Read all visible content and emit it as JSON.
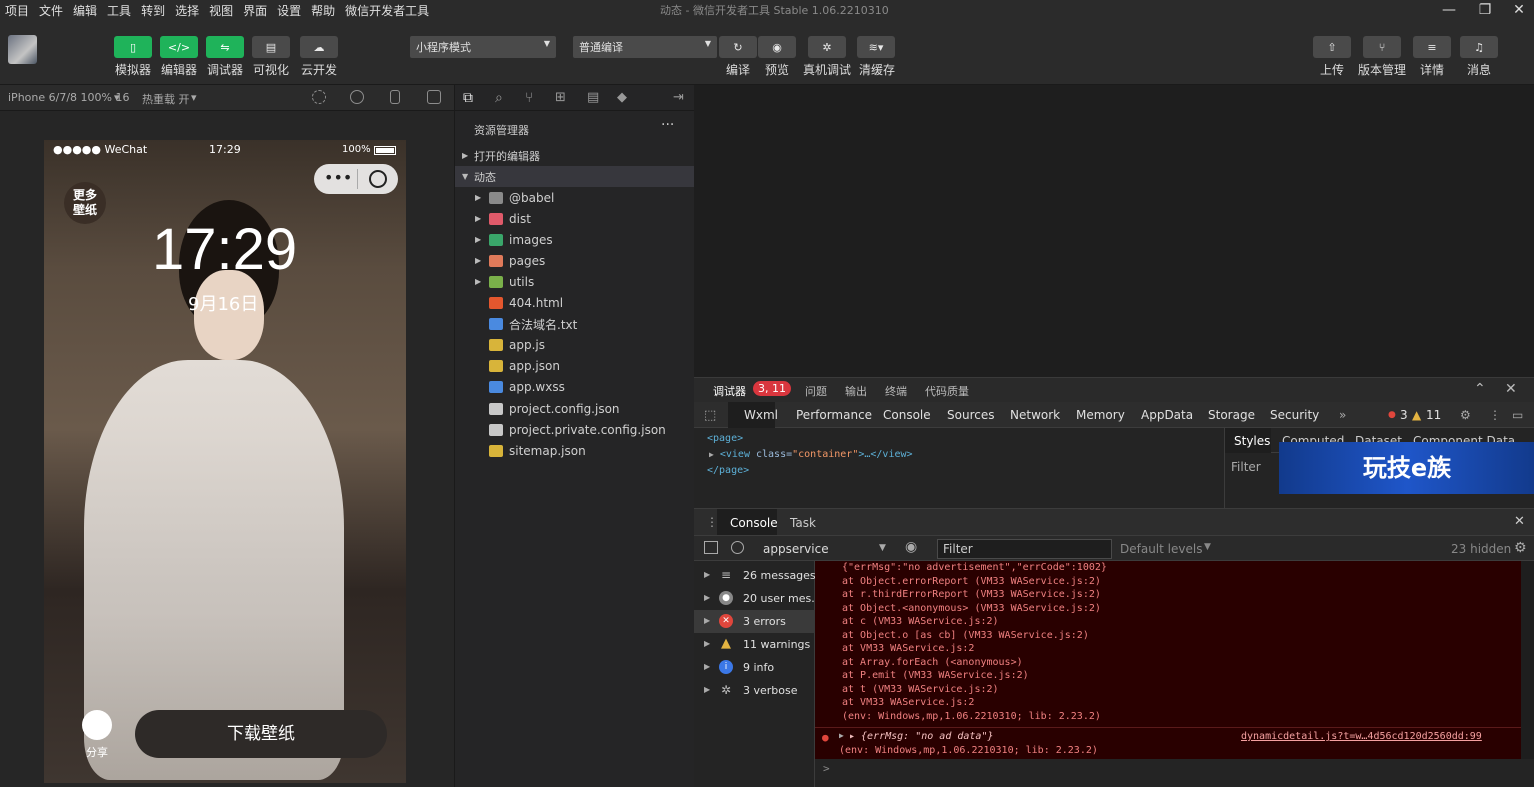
{
  "menubar": {
    "items": [
      "项目",
      "文件",
      "编辑",
      "工具",
      "转到",
      "选择",
      "视图",
      "界面",
      "设置",
      "帮助",
      "微信开发者工具"
    ],
    "window_title": "动态 - 微信开发者工具 Stable 1.06.2210310"
  },
  "toolbar": {
    "simulator": "模拟器",
    "editor": "编辑器",
    "debugger": "调试器",
    "visual": "可视化",
    "cloud": "云开发",
    "mode_select": "小程序模式",
    "compile_select": "普通编译",
    "compile": "编译",
    "preview": "预览",
    "real_debug": "真机调试",
    "clear_cache": "清缓存",
    "upload": "上传",
    "version": "版本管理",
    "detail": "详情",
    "message": "消息"
  },
  "simbar": {
    "device": "iPhone 6/7/8 100% 16",
    "hotreload": "热重载 开"
  },
  "phone": {
    "carrier": "●●●●● WeChat",
    "time": "17:29",
    "battery": "100%",
    "badge": "更多壁纸",
    "clock": "17:29",
    "date": "9月16日",
    "share": "分享",
    "download": "下载壁纸"
  },
  "explorer": {
    "title": "资源管理器",
    "open_editors": "打开的编辑器",
    "project": "动态",
    "items": [
      {
        "name": "@babel",
        "type": "folder",
        "color": "#8a8a8a"
      },
      {
        "name": "dist",
        "type": "folder",
        "color": "#e05a6a"
      },
      {
        "name": "images",
        "type": "folder",
        "color": "#3aa66a"
      },
      {
        "name": "pages",
        "type": "folder",
        "color": "#e07a5a"
      },
      {
        "name": "utils",
        "type": "folder",
        "color": "#7ab04a"
      },
      {
        "name": "404.html",
        "type": "file",
        "color": "#e4572e"
      },
      {
        "name": "合法域名.txt",
        "type": "file",
        "color": "#4a8ae0"
      },
      {
        "name": "app.js",
        "type": "file",
        "color": "#d8b43a"
      },
      {
        "name": "app.json",
        "type": "file",
        "color": "#d8b43a"
      },
      {
        "name": "app.wxss",
        "type": "file",
        "color": "#4a8ae0"
      },
      {
        "name": "project.config.json",
        "type": "file",
        "color": "#c8c8c8"
      },
      {
        "name": "project.private.config.json",
        "type": "file",
        "color": "#c8c8c8"
      },
      {
        "name": "sitemap.json",
        "type": "file",
        "color": "#d8b43a"
      }
    ]
  },
  "devtools_tabs": {
    "debugger": "调试器",
    "badge": "3, 11",
    "issues": "问题",
    "output": "输出",
    "terminal": "终端",
    "code_quality": "代码质量"
  },
  "chrome_tabs": [
    "Wxml",
    "Performance",
    "Console",
    "Sources",
    "Network",
    "Memory",
    "AppData",
    "Storage",
    "Security"
  ],
  "chrome_counts": {
    "errors": "3",
    "warnings": "11"
  },
  "wxml": {
    "line1": "<page>",
    "line2_tag": "<view ",
    "line2_attr": "class=",
    "line2_val": "\"container\"",
    "line2_end": ">…</view>",
    "line3": "</page>"
  },
  "styles": {
    "tabs": [
      "Styles",
      "Computed",
      "Dataset",
      "Component Data"
    ],
    "filter": "Filter",
    "watermark": "玩技e族"
  },
  "console_tabs": [
    "Console",
    "Task"
  ],
  "filterbar": {
    "context": "appservice",
    "filter_placeholder": "Filter",
    "levels": "Default levels",
    "hidden": "23 hidden"
  },
  "sidebar": [
    {
      "label": "26 messages",
      "icon": "list-icon",
      "color": "#888"
    },
    {
      "label": "20 user mes...",
      "icon": "user-icon",
      "color": "#888"
    },
    {
      "label": "3 errors",
      "icon": "error-icon",
      "color": "#e0463c"
    },
    {
      "label": "11 warnings",
      "icon": "warning-icon",
      "color": "#e3b341"
    },
    {
      "label": "9 info",
      "icon": "info-icon",
      "color": "#3b78e7"
    },
    {
      "label": "3 verbose",
      "icon": "verbose-icon",
      "color": "#888"
    }
  ],
  "errlog": {
    "lines": [
      "{\"errMsg\":\"no advertisement\",\"errCode\":1002}",
      "    at Object.errorReport (VM33 WAService.js:2)",
      "    at r.thirdErrorReport (VM33 WAService.js:2)",
      "    at Object.<anonymous> (VM33 WAService.js:2)",
      "    at c (VM33 WAService.js:2)",
      "    at Object.o [as cb] (VM33 WAService.js:2)",
      "    at VM33 WAService.js:2",
      "    at Array.forEach (<anonymous>)",
      "    at P.emit (VM33 WAService.js:2)",
      "    at t (VM33 WAService.js:2)",
      "    at VM33 WAService.js:2",
      "(env: Windows,mp,1.06.2210310; lib: 2.23.2)"
    ],
    "second_msg": "▸ {errMsg: \"no ad data\"}",
    "second_link": "dynamicdetail.js?t=w…4d56cd120d2560dd:99",
    "second_env": "(env: Windows,mp,1.06.2210310; lib: 2.23.2)"
  },
  "prompt": ">"
}
